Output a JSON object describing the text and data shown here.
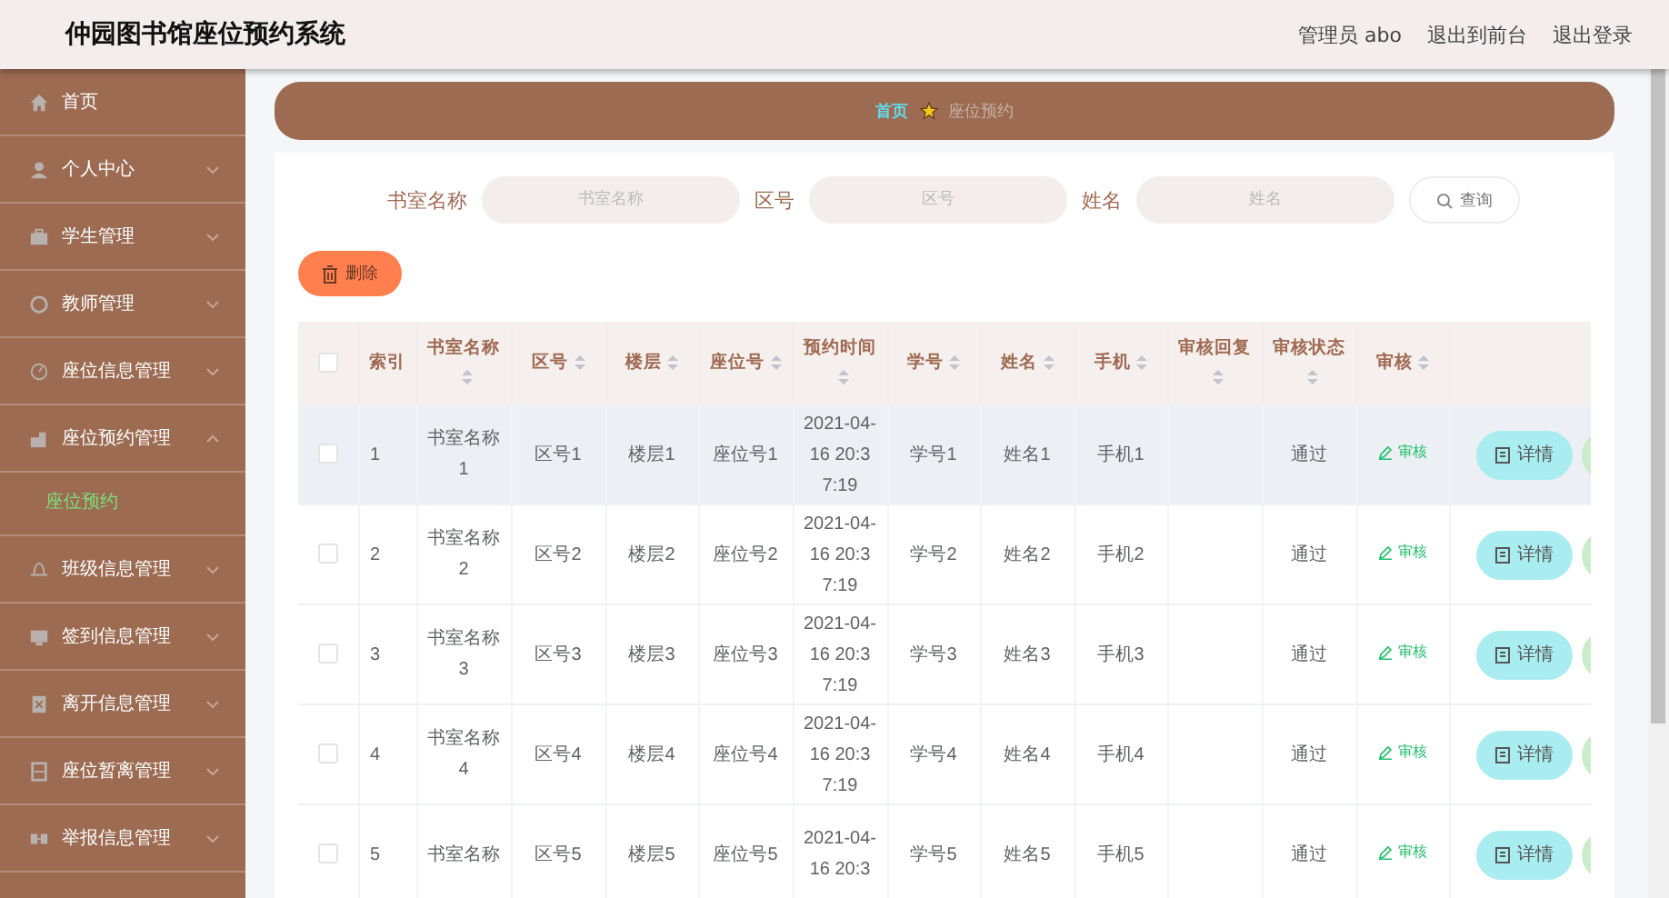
{
  "header": {
    "title": "仲园图书馆座位预约系统",
    "user": "管理员 abo",
    "links": [
      "退出到前台",
      "退出登录"
    ]
  },
  "sidebar": {
    "items": [
      {
        "label": "首页",
        "kind": "link"
      },
      {
        "label": "个人中心",
        "kind": "menu",
        "expanded": false
      },
      {
        "label": "学生管理",
        "kind": "menu",
        "expanded": false
      },
      {
        "label": "教师管理",
        "kind": "menu",
        "expanded": false
      },
      {
        "label": "座位信息管理",
        "kind": "menu",
        "expanded": false
      },
      {
        "label": "座位预约管理",
        "kind": "menu",
        "expanded": true,
        "children": [
          {
            "label": "座位预约",
            "selected": true
          }
        ]
      },
      {
        "label": "班级信息管理",
        "kind": "menu",
        "expanded": false
      },
      {
        "label": "签到信息管理",
        "kind": "menu",
        "expanded": false
      },
      {
        "label": "离开信息管理",
        "kind": "menu",
        "expanded": false
      },
      {
        "label": "座位暂离管理",
        "kind": "menu",
        "expanded": false
      },
      {
        "label": "举报信息管理",
        "kind": "menu",
        "expanded": false
      }
    ]
  },
  "breadcrumb": [
    "首页",
    "座位预约"
  ],
  "search": {
    "fields": [
      {
        "label": "书室名称",
        "placeholder": "书室名称"
      },
      {
        "label": "区号",
        "placeholder": "区号"
      },
      {
        "label": "姓名",
        "placeholder": "姓名"
      }
    ],
    "button": "查询"
  },
  "delete_button": "删除",
  "table": {
    "columns": [
      {
        "label": "索引",
        "sortable": false
      },
      {
        "label": "书室名称",
        "sortable": true
      },
      {
        "label": "区号",
        "sortable": true
      },
      {
        "label": "楼层",
        "sortable": true
      },
      {
        "label": "座位号",
        "sortable": true
      },
      {
        "label": "预约时间",
        "sortable": true
      },
      {
        "label": "学号",
        "sortable": true
      },
      {
        "label": "姓名",
        "sortable": true
      },
      {
        "label": "手机",
        "sortable": true
      },
      {
        "label": "审核回复",
        "sortable": true
      },
      {
        "label": "审核状态",
        "sortable": true
      },
      {
        "label": "审核",
        "sortable": true
      }
    ],
    "all_selected": false,
    "rows": [
      {
        "selected": false,
        "highlighted": true,
        "cells": [
          "1",
          "书室名称1",
          "区号1",
          "楼层1",
          "座位号1",
          "2021-04-16 20:37:19",
          "学号1",
          "姓名1",
          "手机1",
          "",
          "通过"
        ],
        "review": "审核",
        "details": "详情"
      },
      {
        "selected": false,
        "highlighted": false,
        "cells": [
          "2",
          "书室名称2",
          "区号2",
          "楼层2",
          "座位号2",
          "2021-04-16 20:37:19",
          "学号2",
          "姓名2",
          "手机2",
          "",
          "通过"
        ],
        "review": "审核",
        "details": "详情"
      },
      {
        "selected": false,
        "highlighted": false,
        "cells": [
          "3",
          "书室名称3",
          "区号3",
          "楼层3",
          "座位号3",
          "2021-04-16 20:37:19",
          "学号3",
          "姓名3",
          "手机3",
          "",
          "通过"
        ],
        "review": "审核",
        "details": "详情"
      },
      {
        "selected": false,
        "highlighted": false,
        "cells": [
          "4",
          "书室名称4",
          "区号4",
          "楼层4",
          "座位号4",
          "2021-04-16 20:37:19",
          "学号4",
          "姓名4",
          "手机4",
          "",
          "通过"
        ],
        "review": "审核",
        "details": "详情"
      },
      {
        "selected": false,
        "highlighted": false,
        "cells": [
          "5",
          "书室名称",
          "区号5",
          "楼层5",
          "座位号5",
          "2021-04-16 20:3",
          "学号5",
          "姓名5",
          "手机5",
          "",
          "通过"
        ],
        "review": "审核",
        "details": "详情"
      }
    ]
  }
}
